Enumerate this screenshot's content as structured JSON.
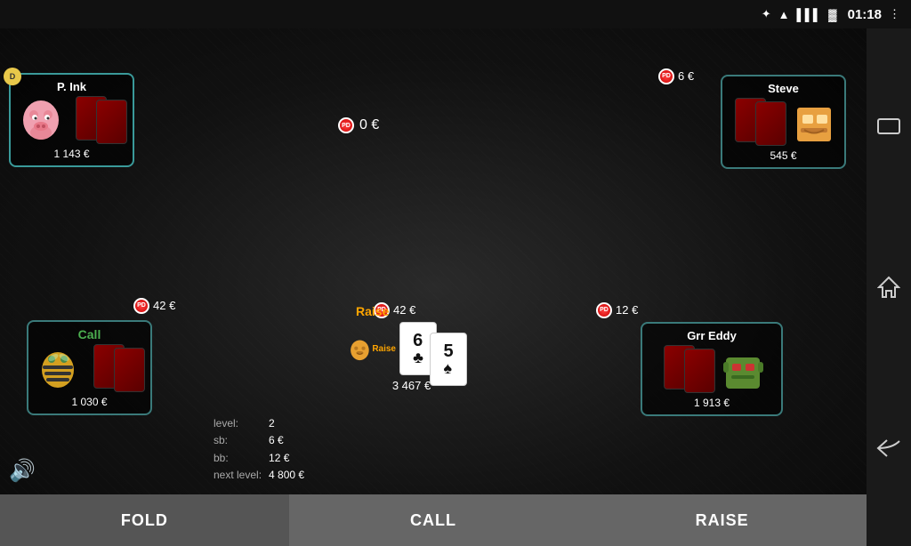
{
  "statusBar": {
    "time": "01:18",
    "bluetoothIcon": "⬡",
    "wifiIcon": "▲",
    "signalIcon": "▌",
    "batteryIcon": "▬",
    "moreIcon": "⋮"
  },
  "navButtons": {
    "windowIcon": "⬜",
    "homeIcon": "⌂",
    "backIcon": "↩"
  },
  "players": {
    "pink": {
      "name": "P. Ink",
      "money": "1 143 €",
      "emoji": "🐷",
      "isDealer": true,
      "color": "#3a7a7a"
    },
    "steve": {
      "name": "Steve",
      "money": "545 €",
      "emoji": "🤖",
      "bet": "6 €"
    },
    "bee": {
      "name": "",
      "money": "1 030 €",
      "emoji": "🐝",
      "action": "Call",
      "bet": "42 €"
    },
    "main": {
      "name": "",
      "money": "3 467 €",
      "emoji": "🥚",
      "action": "Raise",
      "bet": "42 €"
    },
    "grr": {
      "name": "Grr Eddy",
      "money": "1 913 €",
      "emoji": "🤖",
      "bet": "12 €"
    }
  },
  "pot": {
    "amount": "0 €"
  },
  "gameInfo": {
    "levelLabel": "level:",
    "levelValue": "2",
    "sbLabel": "sb:",
    "sbValue": "6 €",
    "bbLabel": "bb:",
    "bbValue": "12 €",
    "nextLevelLabel": "next level:",
    "nextLevelValue": "4 800 €"
  },
  "communityCards": [
    {
      "value": "6",
      "suit": "♣",
      "color": "black"
    },
    {
      "value": "5",
      "suit": "♠",
      "color": "black"
    }
  ],
  "buttons": {
    "fold": "FOLD",
    "call": "CALL",
    "raise": "RAISE"
  },
  "sound": "🔊"
}
